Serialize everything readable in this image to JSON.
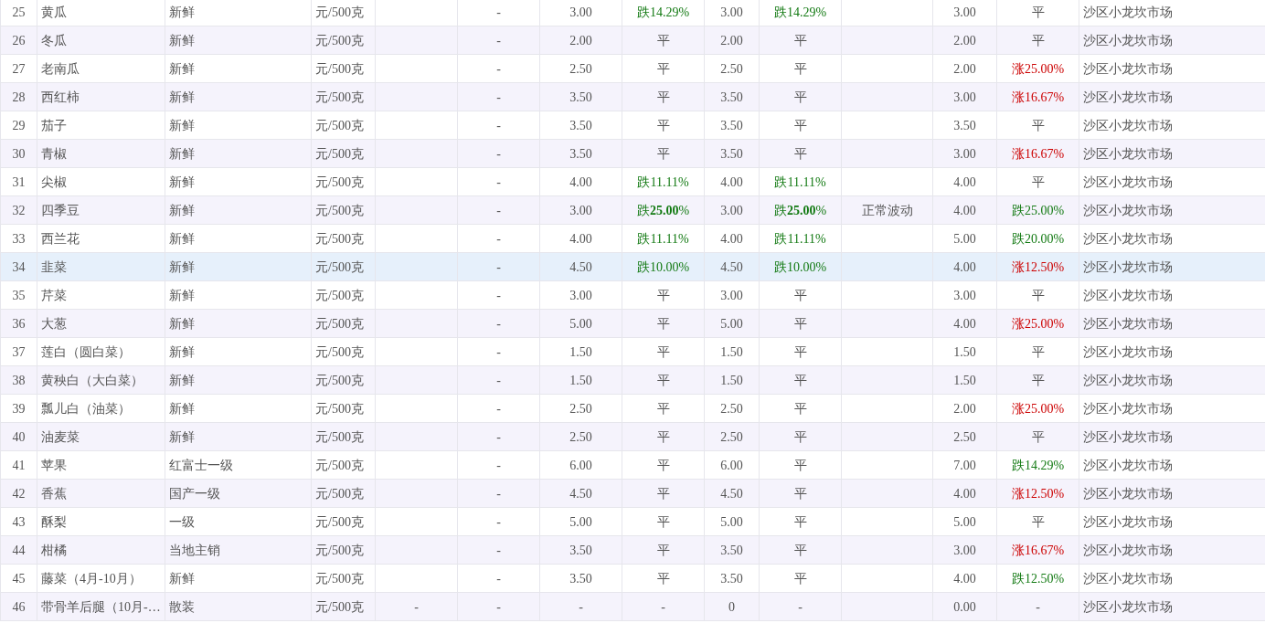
{
  "rows": [
    {
      "no": "25",
      "name": "黄瓜",
      "spec": "新鲜",
      "unit": "元/500克",
      "col_6": "-",
      "price_1": "3.00",
      "change_1": {
        "text": "跌14.29%",
        "color": "#137a13"
      },
      "price_2": "3.00",
      "change_2": {
        "text": "跌14.29%",
        "color": "#137a13"
      },
      "price_3": "3.00",
      "change_3": {
        "text": "平",
        "color": "#555555"
      },
      "market": "沙区小龙坎市场",
      "selected": false
    },
    {
      "no": "26",
      "name": "冬瓜",
      "spec": "新鲜",
      "unit": "元/500克",
      "col_6": "-",
      "price_1": "2.00",
      "change_1": {
        "text": "平",
        "color": "#555555"
      },
      "price_2": "2.00",
      "change_2": {
        "text": "平",
        "color": "#555555"
      },
      "price_3": "2.00",
      "change_3": {
        "text": "平",
        "color": "#555555"
      },
      "market": "沙区小龙坎市场",
      "selected": false
    },
    {
      "no": "27",
      "name": "老南瓜",
      "spec": "新鲜",
      "unit": "元/500克",
      "col_6": "-",
      "price_1": "2.50",
      "change_1": {
        "text": "平",
        "color": "#555555"
      },
      "price_2": "2.50",
      "change_2": {
        "text": "平",
        "color": "#555555"
      },
      "price_3": "2.00",
      "change_3": {
        "text": "涨25.00%",
        "color": "#cc0000"
      },
      "market": "沙区小龙坎市场",
      "selected": false
    },
    {
      "no": "28",
      "name": "西红柿",
      "spec": "新鲜",
      "unit": "元/500克",
      "col_6": "-",
      "price_1": "3.50",
      "change_1": {
        "text": "平",
        "color": "#555555"
      },
      "price_2": "3.50",
      "change_2": {
        "text": "平",
        "color": "#555555"
      },
      "price_3": "3.00",
      "change_3": {
        "text": "涨16.67%",
        "color": "#cc0000"
      },
      "market": "沙区小龙坎市场",
      "selected": false
    },
    {
      "no": "29",
      "name": "茄子",
      "spec": "新鲜",
      "unit": "元/500克",
      "col_6": "-",
      "price_1": "3.50",
      "change_1": {
        "text": "平",
        "color": "#555555"
      },
      "price_2": "3.50",
      "change_2": {
        "text": "平",
        "color": "#555555"
      },
      "price_3": "3.50",
      "change_3": {
        "text": "平",
        "color": "#555555"
      },
      "market": "沙区小龙坎市场",
      "selected": false
    },
    {
      "no": "30",
      "name": "青椒",
      "spec": "新鲜",
      "unit": "元/500克",
      "col_6": "-",
      "price_1": "3.50",
      "change_1": {
        "text": "平",
        "color": "#555555"
      },
      "price_2": "3.50",
      "change_2": {
        "text": "平",
        "color": "#555555"
      },
      "price_3": "3.00",
      "change_3": {
        "text": "涨16.67%",
        "color": "#cc0000"
      },
      "market": "沙区小龙坎市场",
      "selected": false
    },
    {
      "no": "31",
      "name": "尖椒",
      "spec": "新鲜",
      "unit": "元/500克",
      "col_6": "-",
      "price_1": "4.00",
      "change_1": {
        "text": "跌11.11%",
        "color": "#137a13"
      },
      "price_2": "4.00",
      "change_2": {
        "text": "跌11.11%",
        "color": "#137a13"
      },
      "price_3": "4.00",
      "change_3": {
        "text": "平",
        "color": "#555555"
      },
      "market": "沙区小龙坎市场",
      "selected": false
    },
    {
      "no": "32",
      "name": "四季豆",
      "spec": "新鲜",
      "unit": "元/500克",
      "col_6": "-",
      "price_1": "3.00",
      "change_1": {
        "text": "跌**25.00**%",
        "color": "#137a13"
      },
      "price_2": "3.00",
      "change_2": {
        "text": "跌**25.00**%",
        "color": "#137a13"
      },
      "note": "正常波动",
      "price_3": "4.00",
      "change_3": {
        "text": "跌25.00%",
        "color": "#137a13"
      },
      "market": "沙区小龙坎市场",
      "selected": false
    },
    {
      "no": "33",
      "name": "西兰花",
      "spec": "新鲜",
      "unit": "元/500克",
      "col_6": "-",
      "price_1": "4.00",
      "change_1": {
        "text": "跌11.11%",
        "color": "#137a13"
      },
      "price_2": "4.00",
      "change_2": {
        "text": "跌11.11%",
        "color": "#137a13"
      },
      "price_3": "5.00",
      "change_3": {
        "text": "跌20.00%",
        "color": "#137a13"
      },
      "market": "沙区小龙坎市场",
      "selected": false
    },
    {
      "no": "34",
      "name": "韭菜",
      "spec": "新鲜",
      "unit": "元/500克",
      "col_6": "-",
      "price_1": "4.50",
      "change_1": {
        "text": "跌10.00%",
        "color": "#137a13"
      },
      "price_2": "4.50",
      "change_2": {
        "text": "跌10.00%",
        "color": "#137a13"
      },
      "price_3": "4.00",
      "change_3": {
        "text": "涨12.50%",
        "color": "#cc0000"
      },
      "market": "沙区小龙坎市场",
      "selected": true
    },
    {
      "no": "35",
      "name": "芹菜",
      "spec": "新鲜",
      "unit": "元/500克",
      "col_6": "-",
      "price_1": "3.00",
      "change_1": {
        "text": "平",
        "color": "#555555"
      },
      "price_2": "3.00",
      "change_2": {
        "text": "平",
        "color": "#555555"
      },
      "price_3": "3.00",
      "change_3": {
        "text": "平",
        "color": "#555555"
      },
      "market": "沙区小龙坎市场",
      "selected": false
    },
    {
      "no": "36",
      "name": "大葱",
      "spec": "新鲜",
      "unit": "元/500克",
      "col_6": "-",
      "price_1": "5.00",
      "change_1": {
        "text": "平",
        "color": "#555555"
      },
      "price_2": "5.00",
      "change_2": {
        "text": "平",
        "color": "#555555"
      },
      "price_3": "4.00",
      "change_3": {
        "text": "涨25.00%",
        "color": "#cc0000"
      },
      "market": "沙区小龙坎市场",
      "selected": false
    },
    {
      "no": "37",
      "name": "莲白（圆白菜）",
      "spec": "新鲜",
      "unit": "元/500克",
      "col_6": "-",
      "price_1": "1.50",
      "change_1": {
        "text": "平",
        "color": "#555555"
      },
      "price_2": "1.50",
      "change_2": {
        "text": "平",
        "color": "#555555"
      },
      "price_3": "1.50",
      "change_3": {
        "text": "平",
        "color": "#555555"
      },
      "market": "沙区小龙坎市场",
      "selected": false
    },
    {
      "no": "38",
      "name": "黄秧白（大白菜）",
      "spec": "新鲜",
      "unit": "元/500克",
      "col_6": "-",
      "price_1": "1.50",
      "change_1": {
        "text": "平",
        "color": "#555555"
      },
      "price_2": "1.50",
      "change_2": {
        "text": "平",
        "color": "#555555"
      },
      "price_3": "1.50",
      "change_3": {
        "text": "平",
        "color": "#555555"
      },
      "market": "沙区小龙坎市场",
      "selected": false
    },
    {
      "no": "39",
      "name": "瓢儿白（油菜）",
      "spec": "新鲜",
      "unit": "元/500克",
      "col_6": "-",
      "price_1": "2.50",
      "change_1": {
        "text": "平",
        "color": "#555555"
      },
      "price_2": "2.50",
      "change_2": {
        "text": "平",
        "color": "#555555"
      },
      "price_3": "2.00",
      "change_3": {
        "text": "涨25.00%",
        "color": "#cc0000"
      },
      "market": "沙区小龙坎市场",
      "selected": false
    },
    {
      "no": "40",
      "name": "油麦菜",
      "spec": "新鲜",
      "unit": "元/500克",
      "col_6": "-",
      "price_1": "2.50",
      "change_1": {
        "text": "平",
        "color": "#555555"
      },
      "price_2": "2.50",
      "change_2": {
        "text": "平",
        "color": "#555555"
      },
      "price_3": "2.50",
      "change_3": {
        "text": "平",
        "color": "#555555"
      },
      "market": "沙区小龙坎市场",
      "selected": false
    },
    {
      "no": "41",
      "name": "苹果",
      "spec": "红富士一级",
      "unit": "元/500克",
      "col_6": "-",
      "price_1": "6.00",
      "change_1": {
        "text": "平",
        "color": "#555555"
      },
      "price_2": "6.00",
      "change_2": {
        "text": "平",
        "color": "#555555"
      },
      "price_3": "7.00",
      "change_3": {
        "text": "跌14.29%",
        "color": "#137a13"
      },
      "market": "沙区小龙坎市场",
      "selected": false
    },
    {
      "no": "42",
      "name": "香蕉",
      "spec": "国产一级",
      "unit": "元/500克",
      "col_6": "-",
      "price_1": "4.50",
      "change_1": {
        "text": "平",
        "color": "#555555"
      },
      "price_2": "4.50",
      "change_2": {
        "text": "平",
        "color": "#555555"
      },
      "price_3": "4.00",
      "change_3": {
        "text": "涨12.50%",
        "color": "#cc0000"
      },
      "market": "沙区小龙坎市场",
      "selected": false
    },
    {
      "no": "43",
      "name": "酥梨",
      "spec": "一级",
      "unit": "元/500克",
      "col_6": "-",
      "price_1": "5.00",
      "change_1": {
        "text": "平",
        "color": "#555555"
      },
      "price_2": "5.00",
      "change_2": {
        "text": "平",
        "color": "#555555"
      },
      "price_3": "5.00",
      "change_3": {
        "text": "平",
        "color": "#555555"
      },
      "market": "沙区小龙坎市场",
      "selected": false
    },
    {
      "no": "44",
      "name": "柑橘",
      "spec": "当地主销",
      "unit": "元/500克",
      "col_6": "-",
      "price_1": "3.50",
      "change_1": {
        "text": "平",
        "color": "#555555"
      },
      "price_2": "3.50",
      "change_2": {
        "text": "平",
        "color": "#555555"
      },
      "price_3": "3.00",
      "change_3": {
        "text": "涨16.67%",
        "color": "#cc0000"
      },
      "market": "沙区小龙坎市场",
      "selected": false
    },
    {
      "no": "45",
      "name": "藤菜（4月-10月）",
      "spec": "新鲜",
      "unit": "元/500克",
      "col_6": "-",
      "price_1": "3.50",
      "change_1": {
        "text": "平",
        "color": "#555555"
      },
      "price_2": "3.50",
      "change_2": {
        "text": "平",
        "color": "#555555"
      },
      "price_3": "4.00",
      "change_3": {
        "text": "跌12.50%",
        "color": "#137a13"
      },
      "market": "沙区小龙坎市场",
      "selected": false
    },
    {
      "no": "46",
      "name": "带骨羊后腿（10月-…",
      "spec": "散装",
      "unit": "元/500克",
      "col_5": "-",
      "col_6": "-",
      "price_1": "-",
      "change_1": {
        "text": "-",
        "color": "#555555"
      },
      "price_2": "0",
      "change_2": {
        "text": "-",
        "color": "#555555"
      },
      "price_3": "0.00",
      "change_3": {
        "text": "-",
        "color": "#555555"
      },
      "market": "沙区小龙坎市场",
      "selected": false
    }
  ]
}
